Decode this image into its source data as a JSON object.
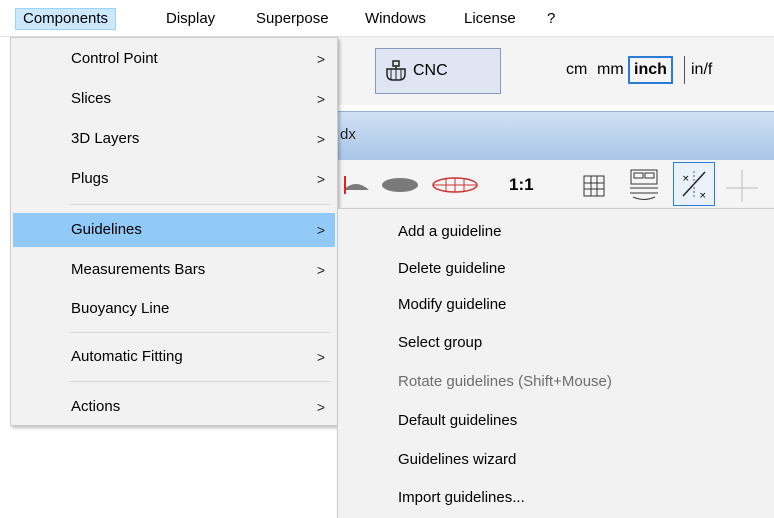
{
  "menubar": {
    "items": [
      {
        "label": "Components",
        "active": true
      },
      {
        "label": "Display"
      },
      {
        "label": "Superpose"
      },
      {
        "label": "Windows"
      },
      {
        "label": "License"
      },
      {
        "label": "?"
      }
    ]
  },
  "background": {
    "cnc_button_label": "CNC",
    "units": [
      "cm",
      "mm",
      "inch",
      "in/f"
    ],
    "selected_unit": "inch",
    "band_text": "dx",
    "ratio_label": "1:1"
  },
  "components_menu": {
    "items": [
      {
        "label": "Control Point",
        "submenu_arrow": ">"
      },
      {
        "label": "Slices",
        "submenu_arrow": ">"
      },
      {
        "label": "3D Layers",
        "submenu_arrow": ">"
      },
      {
        "label": "Plugs",
        "submenu_arrow": ">"
      },
      {
        "label": "Guidelines",
        "submenu_arrow": ">",
        "highlighted": true
      },
      {
        "label": "Measurements Bars",
        "submenu_arrow": ">"
      },
      {
        "label": "Buoyancy Line"
      },
      {
        "label": "Automatic Fitting",
        "submenu_arrow": ">"
      },
      {
        "label": "Actions",
        "submenu_arrow": ">"
      }
    ]
  },
  "guidelines_submenu": {
    "items": [
      {
        "label": "Add a guideline"
      },
      {
        "label": "Delete guideline"
      },
      {
        "label": "Modify guideline"
      },
      {
        "label": "Select group"
      },
      {
        "label": "Rotate guidelines (Shift+Mouse)",
        "disabled": true
      },
      {
        "label": "Default guidelines"
      },
      {
        "label": "Guidelines wizard"
      },
      {
        "label": "Import guidelines..."
      }
    ]
  },
  "colors": {
    "highlight": "#91c9f7",
    "menubar_active": "#cce8ff",
    "disabled_text": "#6d6d6d",
    "band": "#a9c6e8"
  }
}
